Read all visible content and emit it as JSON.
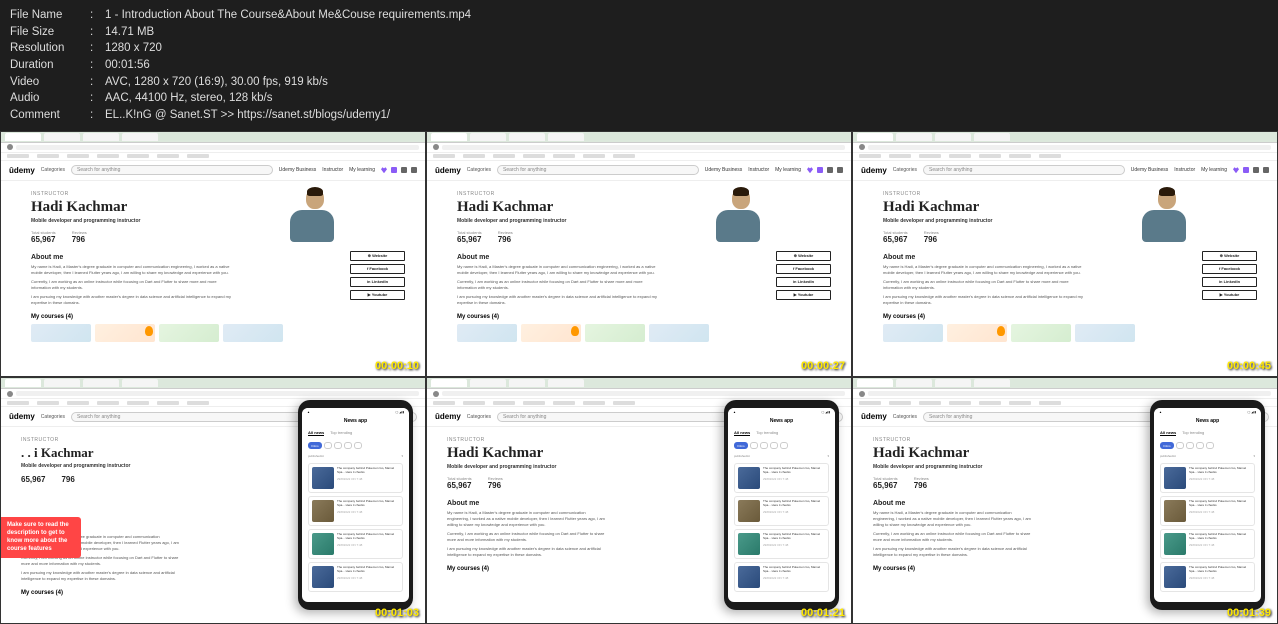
{
  "meta": {
    "rows": [
      {
        "label": "File Name",
        "value": "1 - Introduction About The Course&About Me&Couse requirements.mp4"
      },
      {
        "label": "File Size",
        "value": "14.71 MB"
      },
      {
        "label": "Resolution",
        "value": "1280 x 720"
      },
      {
        "label": "Duration",
        "value": "00:01:56"
      },
      {
        "label": "Video",
        "value": "AVC, 1280 x 720 (16:9), 30.00 fps, 919 kb/s"
      },
      {
        "label": "Audio",
        "value": "AAC, 44100 Hz, stereo, 128 kb/s"
      },
      {
        "label": "Comment",
        "value": "EL..K!nG @ Sanet.ST >> https://sanet.st/blogs/udemy1/"
      }
    ]
  },
  "timestamps": [
    "00:00:10",
    "00:00:27",
    "00:00:45",
    "00:01:03",
    "00:01:21",
    "00:01:39"
  ],
  "udemy": {
    "logo": "ûdemy",
    "categories": "Categories",
    "search_ph": "Search for anything",
    "biz": "Udemy Business",
    "instructor_link": "Instructor",
    "mylearning": "My learning"
  },
  "profile": {
    "label": "INSTRUCTOR",
    "name": "Hadi Kachmar",
    "subtitle": "Mobile developer and programming instructor",
    "stat1_label": "Total students",
    "stat1_val": "65,967",
    "stat2_label": "Reviews",
    "stat2_val": "796",
    "about_h": "About me",
    "about_p1": "My name is Hadi, a Master's degree graduate in computer and communication engineering, I worked as a native mobile developer, then I learned Flutter years ago, I am willing to share my knowledge and experience with you.",
    "about_p2": "Currently, I am working as an online instructor while focusing on Dart and Flutter to share more and more information with my students.",
    "about_p3": "I am pursuing my knowledge with another master's degree in data science and artificial intelligence to expand my expertise in these domains.",
    "courses_h": "My courses (4)"
  },
  "social": {
    "website": "⊕ Website",
    "facebook": "f Facebook",
    "linkedin": "in LinkedIn",
    "youtube": "▶ Youtube"
  },
  "callout": "Make sure to read the description to get to know more about the course features",
  "phone": {
    "title": "News app",
    "tab1": "All news",
    "tab2": "Top trending",
    "chip_main": "Films",
    "meta_left": "publishedAt",
    "card_title": "The company behind Pokemon Go, Marvel Spa... Here it checks",
    "card_date": "29/8/2022 ON 7:48"
  }
}
